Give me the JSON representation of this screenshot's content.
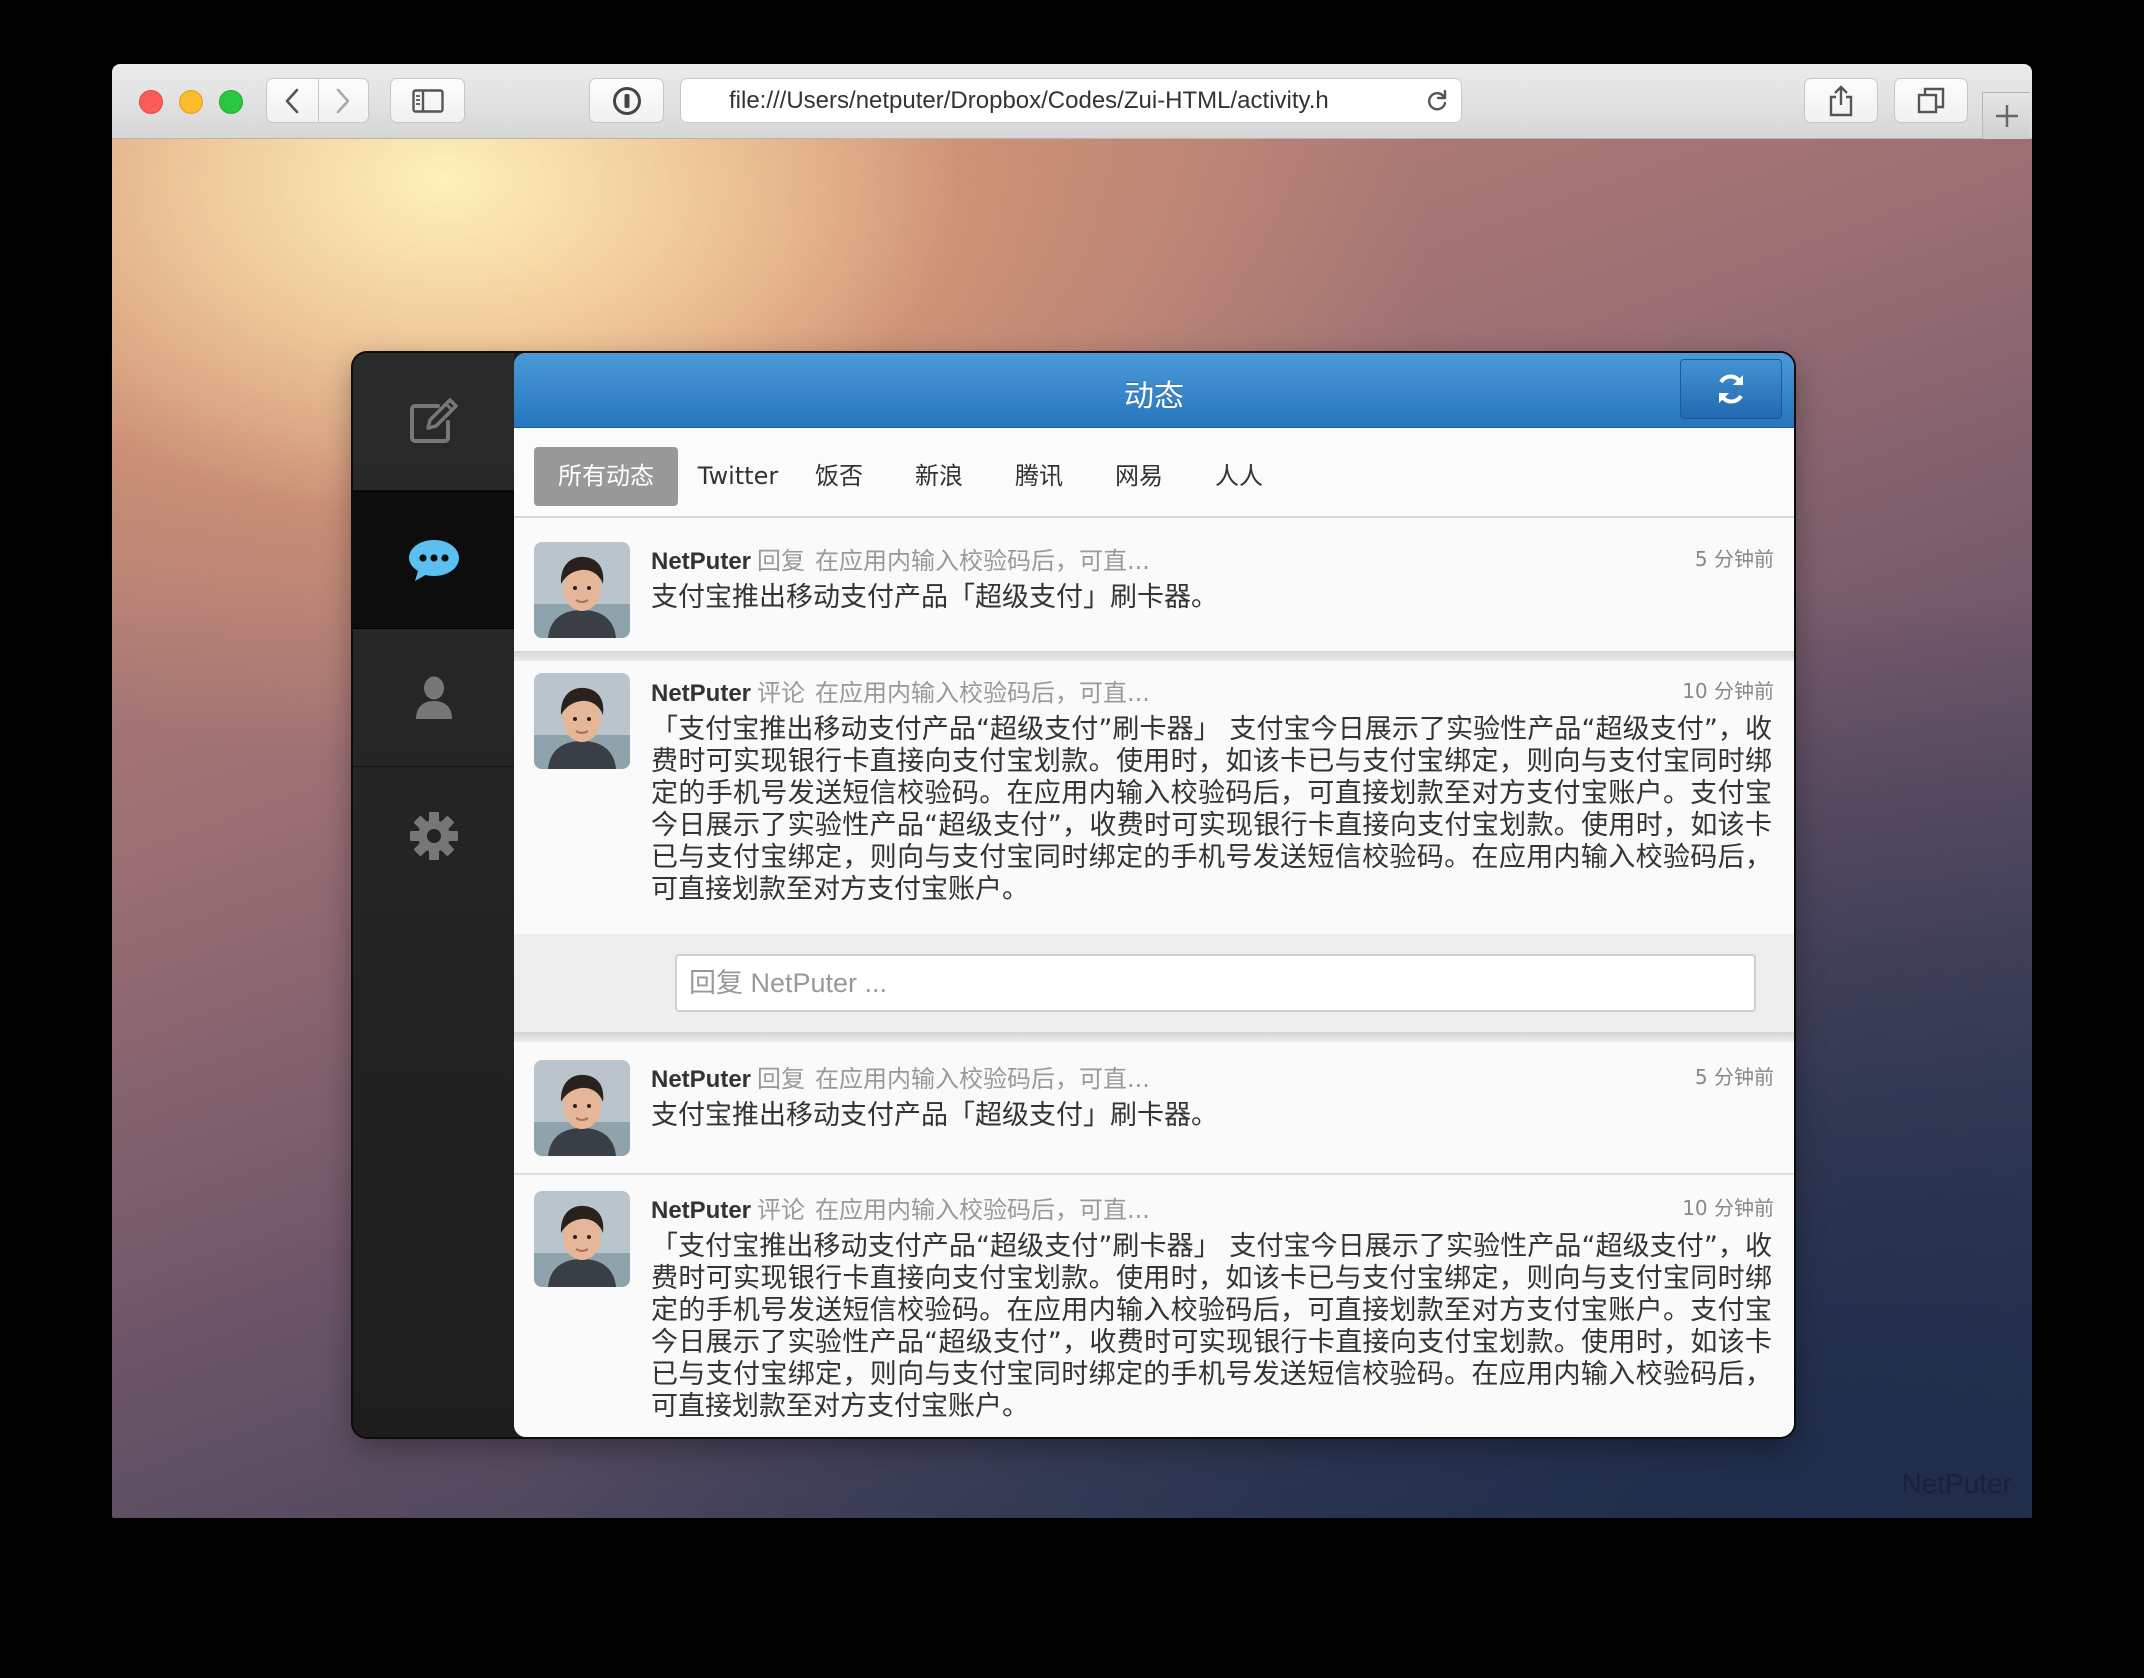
{
  "browser": {
    "url": "file:///Users/netputer/Dropbox/Codes/Zui-HTML/activity.h"
  },
  "desktop": {
    "watermark": "NetPuter"
  },
  "app": {
    "title": "动态",
    "sidebar": [
      {
        "icon": "compose-icon",
        "active": false
      },
      {
        "icon": "chat-bubble-icon",
        "active": true
      },
      {
        "icon": "user-icon",
        "active": false
      },
      {
        "icon": "gear-icon",
        "active": false
      }
    ],
    "filters": [
      "所有动态",
      "Twitter",
      "饭否",
      "新浪",
      "腾讯",
      "网易",
      "人人"
    ],
    "active_filter": "所有动态",
    "posts": [
      {
        "name": "NetPuter",
        "action": "回复",
        "context": "在应用内输入校验码后，可直...",
        "time": "5 分钟前",
        "text": "支付宝推出移动支付产品「超级支付」刷卡器。"
      },
      {
        "name": "NetPuter",
        "action": "评论",
        "context": "在应用内输入校验码后，可直...",
        "time": "10 分钟前",
        "text": "「支付宝推出移动支付产品“超级支付”刷卡器」 支付宝今日展示了实验性产品“超级支付”，收费时可实现银行卡直接向支付宝划款。使用时，如该卡已与支付宝绑定，则向与支付宝同时绑定的手机号发送短信校验码。在应用内输入校验码后，可直接划款至对方支付宝账户。支付宝今日展示了实验性产品“超级支付”，收费时可实现银行卡直接向支付宝划款。使用时，如该卡已与支付宝绑定，则向与支付宝同时绑定的手机号发送短信校验码。在应用内输入校验码后，可直接划款至对方支付宝账户。"
      },
      {
        "name": "NetPuter",
        "action": "回复",
        "context": "在应用内输入校验码后，可直...",
        "time": "5 分钟前",
        "text": "支付宝推出移动支付产品「超级支付」刷卡器。"
      },
      {
        "name": "NetPuter",
        "action": "评论",
        "context": "在应用内输入校验码后，可直...",
        "time": "10 分钟前",
        "text": "「支付宝推出移动支付产品“超级支付”刷卡器」 支付宝今日展示了实验性产品“超级支付”，收费时可实现银行卡直接向支付宝划款。使用时，如该卡已与支付宝绑定，则向与支付宝同时绑定的手机号发送短信校验码。在应用内输入校验码后，可直接划款至对方支付宝账户。支付宝今日展示了实验性产品“超级支付”，收费时可实现银行卡直接向支付宝划款。使用时，如该卡已与支付宝绑定，则向与支付宝同时绑定的手机号发送短信校验码。在应用内输入校验码后，可直接划款至对方支付宝账户。"
      }
    ],
    "reply_placeholder": "回复 NetPuter ..."
  },
  "colors": {
    "header_blue": "#2f82c8",
    "active_icon": "#5bc0f0",
    "active_filter_bg": "#999999"
  }
}
